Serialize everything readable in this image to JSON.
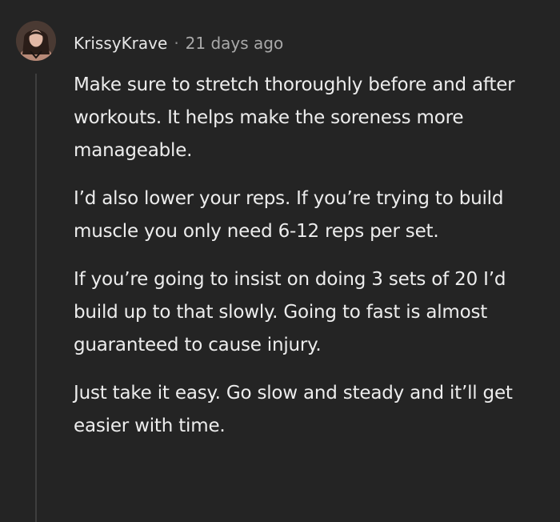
{
  "comment": {
    "author": "KrissyKrave",
    "separator": "·",
    "time_ago": "21 days ago",
    "paragraphs": [
      "Make sure to stretch thoroughly before and after workouts. It helps make the soreness more manageable.",
      "I’d also lower your reps. If you’re trying to build muscle you only need 6-12 reps per set.",
      "If you’re going to insist on doing 3 sets of 20 I’d build up to that slowly. Going to fast is almost guaranteed to cause injury.",
      "Just take it easy. Go slow and steady and it’ll get easier with time."
    ]
  },
  "colors": {
    "background": "#242424",
    "text": "#ededed",
    "muted": "#a9a9a9",
    "thread_line": "#3e3e3e"
  }
}
